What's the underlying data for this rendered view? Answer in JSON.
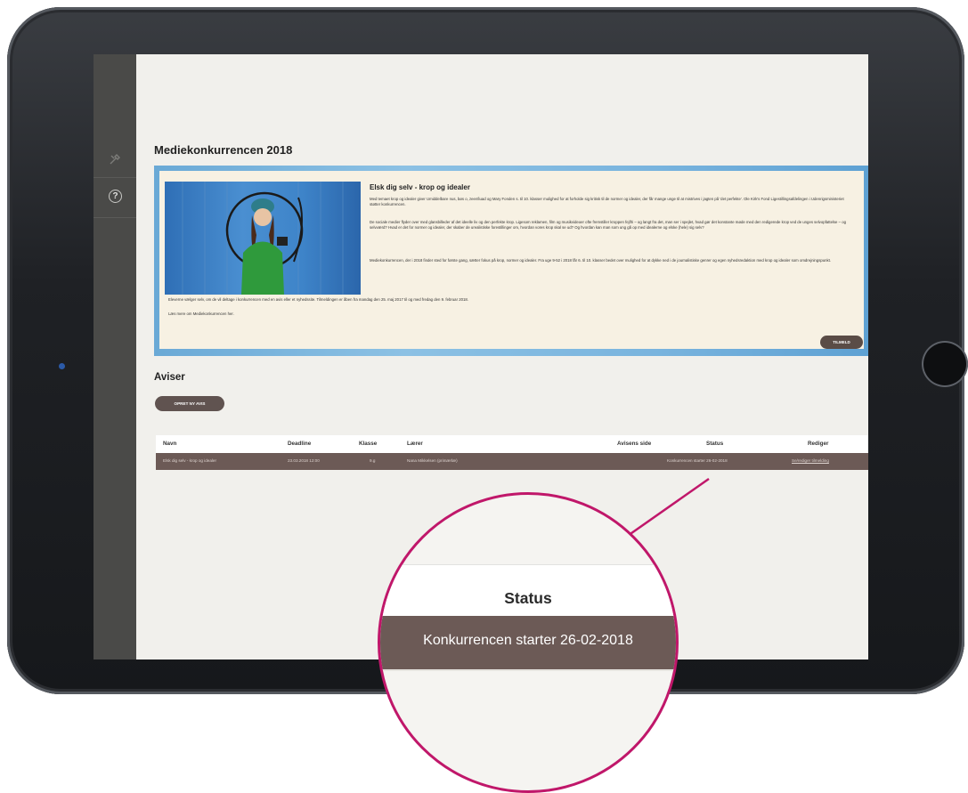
{
  "page": {
    "title": "Mediekonkurrencen 2018",
    "sidebar": {
      "icons": [
        "tools-icon",
        "help-icon"
      ]
    },
    "banner": {
      "heading": "Elsk dig selv - krop og idealer",
      "para1": "Med temaet krop og idealer giver Umiddelbare nus, bøs o, zeenfiuad og Mary Fonden s. til 10. klasser mulighed for at forholde sig kritisk til de normer og idealer, der får mange unge til at mistrives i jagten på 'det perfekte'. Ole Kirk's Fond Ligestillingsafdelingen i Udenrigsministeriet støtter konkurrencen.",
      "para2": "De sociale medier flyder over med glansbilleder af det ideelle liv og den perfekte krop. Ligesom reklamen, film og musikvideoer ofte fremstiller kroppen fejlfri – og langt fra det, man ser i spejlet, hvad gør det konstante møde med den redigerede krop ved de unges selvopfattelse – og selvværd? Hvad er det for normer og idealer, der skaber de urealistiske forestillinger om, hvordan vores krop skal se ud? Og hvordan kan man som ung gå op med idealerne og elske (hele) sig selv?",
      "para3": "Mediekonkurrencen, der i 2018 finder sted for første gang, sætter fokus på krop, normer og idealer. Fra uge 9-52 i 2018 får 6. til 10. klasser bedet over mulighed for at dykke ned i de journalistiske genrer og egen nyhedsredaktion med krop og idealer som omdrejningspunkt.",
      "para4": "Eleverne vælger selv, om de vil deltage i konkurrencen med en avis eller et nyhedssite. Tilmeldingen er åben fra mandag den 25. maj 2017 til og med fredag den 9. februar 2018.",
      "para5": "Læs mere om Mediekonkurrencen her.",
      "button": "TILMELD"
    },
    "aviser": {
      "heading": "Aviser",
      "create_button": "OPRET NY AVIS"
    },
    "table": {
      "headers": {
        "navn": "Navn",
        "deadline": "Deadline",
        "klasse": "Klasse",
        "laerer": "Lærer",
        "side": "Avisens side",
        "status": "Status",
        "rediger": "Rediger"
      },
      "rows": [
        {
          "navn": "Elsk dig selv - krop og idealer",
          "deadline": "23.03.2018 12:00",
          "klasse": "9.g",
          "laerer": "Nana Mikkelsen (primærlæ)",
          "side": "",
          "status": "Konkurrencen starter 26-02-2018",
          "rediger": "Se/rediger tilmelding"
        }
      ]
    },
    "magnifier": {
      "header": "Status",
      "value": "Konkurrencen starter 26-02-2018"
    },
    "colors": {
      "callout": "#c0176a",
      "row": "#6c5a56",
      "sidebar": "#4a4a48"
    }
  }
}
